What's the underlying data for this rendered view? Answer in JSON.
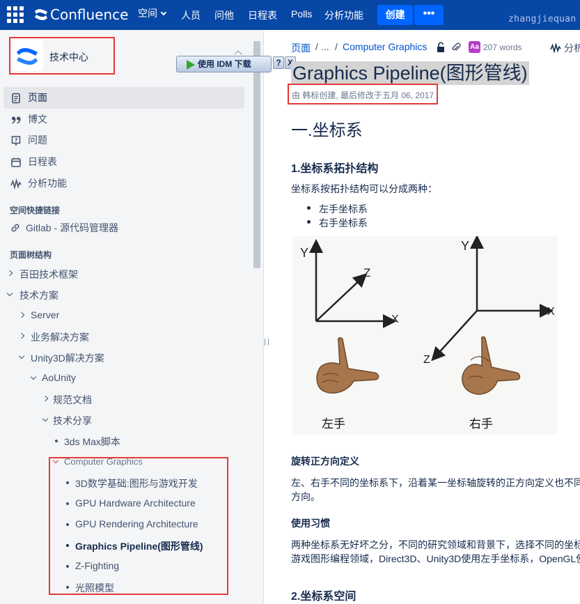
{
  "topbar": {
    "app_name": "Confluence",
    "nav": [
      {
        "label": "空间"
      },
      {
        "label": "人员"
      },
      {
        "label": "问他"
      },
      {
        "label": "日程表"
      },
      {
        "label": "Polls"
      },
      {
        "label": "分析功能"
      }
    ],
    "create_label": "创建",
    "more_label": "•••",
    "username": "zhangjiequan",
    "accent": "#0747a6",
    "button_color": "#0065ff"
  },
  "idm": {
    "label": "使用 IDM 下载",
    "help": "?",
    "close": "X"
  },
  "sidebar": {
    "space_name": "技术中心",
    "menu": [
      {
        "label": "页面",
        "icon": "page-icon"
      },
      {
        "label": "博文",
        "icon": "quote-icon"
      },
      {
        "label": "问题",
        "icon": "question-icon"
      },
      {
        "label": "日程表",
        "icon": "calendar-icon"
      },
      {
        "label": "分析功能",
        "icon": "analytics-icon"
      }
    ],
    "shortcuts_title": "空间快捷链接",
    "shortcut_link": "Gitlab - 源代码管理器",
    "tree_title": "页面树结构",
    "tree": [
      {
        "label": "百田技术框架"
      },
      {
        "label": "技术方案"
      },
      {
        "label": "Server"
      },
      {
        "label": "业务解决方案"
      },
      {
        "label": "Unity3D解决方案"
      },
      {
        "label": "AoUnity"
      },
      {
        "label": "规范文档"
      },
      {
        "label": "技术分享"
      },
      {
        "label": "3ds Max脚本"
      },
      {
        "label": "Computer Graphics"
      },
      {
        "label": "3D数学基础:图形与游戏开发"
      },
      {
        "label": "GPU Hardware Architecture"
      },
      {
        "label": "GPU Rendering Architecture"
      },
      {
        "label": "Graphics Pipeline(图形管线)"
      },
      {
        "label": "Z-Fighting"
      },
      {
        "label": "光照模型"
      }
    ]
  },
  "content": {
    "breadcrumb": {
      "root": "页面",
      "sep": "/",
      "ellipsis": "...",
      "sep2": "/",
      "parent": "Computer Graphics"
    },
    "word_count": "207 words",
    "analytics": "分析功",
    "title": "Graphics Pipeline(图形管线)",
    "byline": "由 韩标创建, 最后修改于五月 06, 2017",
    "h1": "一.坐标系",
    "h3_topology": "1.坐标系拓扑结构",
    "p_topology": "坐标系按拓扑结构可以分成两种：",
    "list": [
      "左手坐标系",
      "右手坐标系"
    ],
    "figure": {
      "left_axes": {
        "y": "Y",
        "z": "Z",
        "x": "X"
      },
      "right_axes": {
        "y": "Y",
        "z": "Z",
        "x": "X"
      },
      "left_caption": "左手",
      "right_caption": "右手"
    },
    "h4_rotation": "旋转正方向定义",
    "p_rotation_1": "左、右手不同的坐标系下，沿着某一坐标轴旋转的正方向定义也不同",
    "p_rotation_2": "方向。",
    "h4_habit": "使用习惯",
    "p_habit_1": "两种坐标系无好坏之分，不同的研究领域和背景下，选择不同的坐标",
    "p_habit_2": "游戏图形编程领域，Direct3D、Unity3D使用左手坐标系，OpenGL使",
    "h3_space": "2.坐标系空间"
  }
}
